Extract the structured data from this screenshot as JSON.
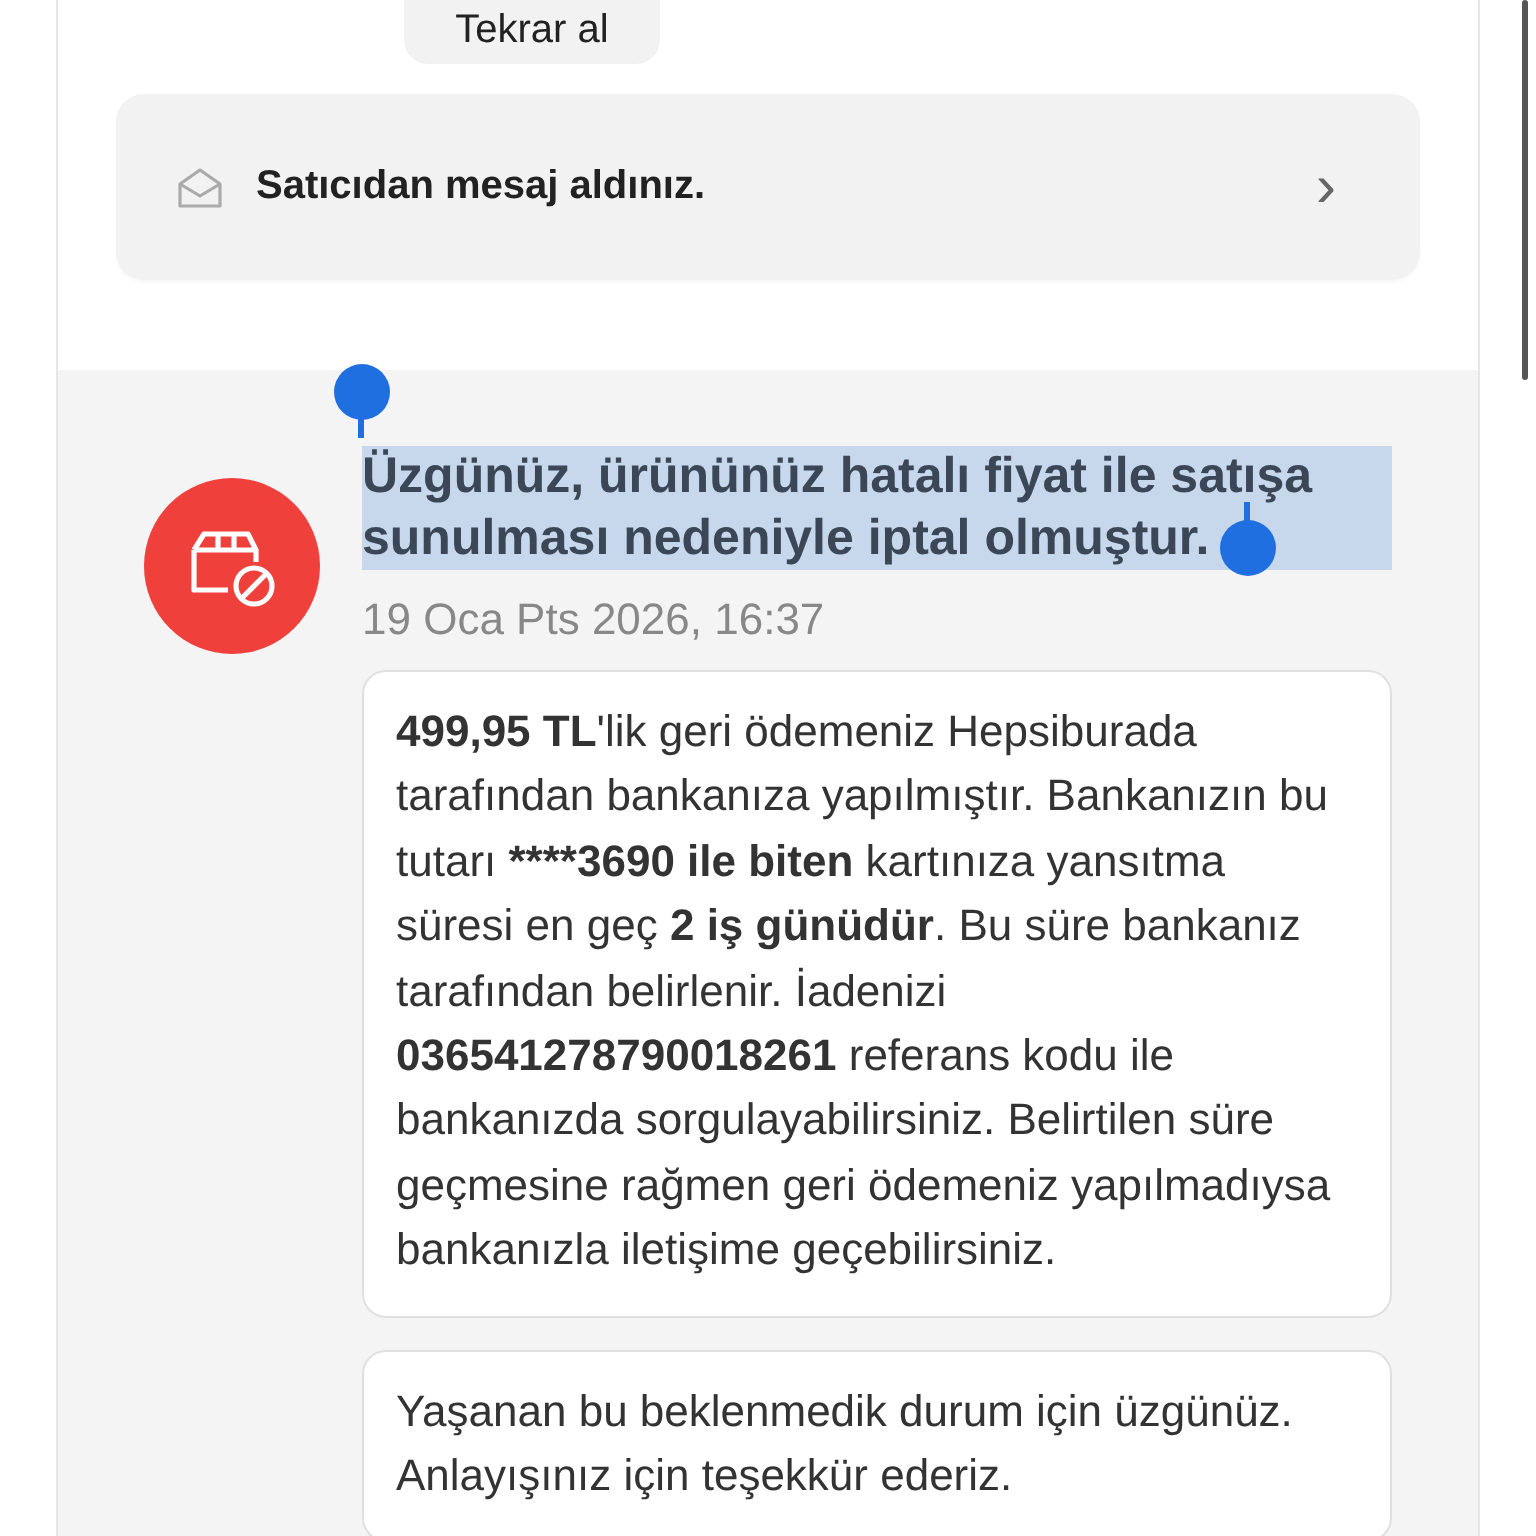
{
  "reorder_button": {
    "label": "Tekrar al"
  },
  "seller_message": {
    "text": "Satıcıdan mesaj aldınız.",
    "chevron": "›"
  },
  "status": {
    "title": "Üzgünüz, ürününüz hatalı fiyat ile satışa sunulması nedeniyle iptal olmuştur.",
    "selected": true,
    "date": "19 Oca Pts 2026, 16:37"
  },
  "messages": [
    {
      "parts": [
        {
          "text": "499,95 TL",
          "bold": true
        },
        {
          "text": "'lik geri ödemeniz Hepsiburada tarafından bankanıza yapılmıştır. Bankanızın bu tutarı ",
          "bold": false
        },
        {
          "text": "****3690 ile biten",
          "bold": true
        },
        {
          "text": " kartınıza yansıtma süresi en geç ",
          "bold": false
        },
        {
          "text": "2 iş günüdür",
          "bold": true
        },
        {
          "text": ". Bu süre bankanız tarafından belirlenir. İadenizi ",
          "bold": false
        },
        {
          "text": "036541278790018261",
          "bold": true
        },
        {
          "text": " referans kodu ile bankanızda sorgulayabilirsiniz. Belirtilen süre geçmesine rağmen geri ödemeniz yapılmadıysa bankanızla iletişime geçebilirsiniz.",
          "bold": false
        }
      ]
    },
    {
      "parts": [
        {
          "text": "Yaşanan bu beklenmedik durum için üzgünüz. Anlayışınız için teşekkür ederiz.",
          "bold": false
        }
      ]
    }
  ]
}
